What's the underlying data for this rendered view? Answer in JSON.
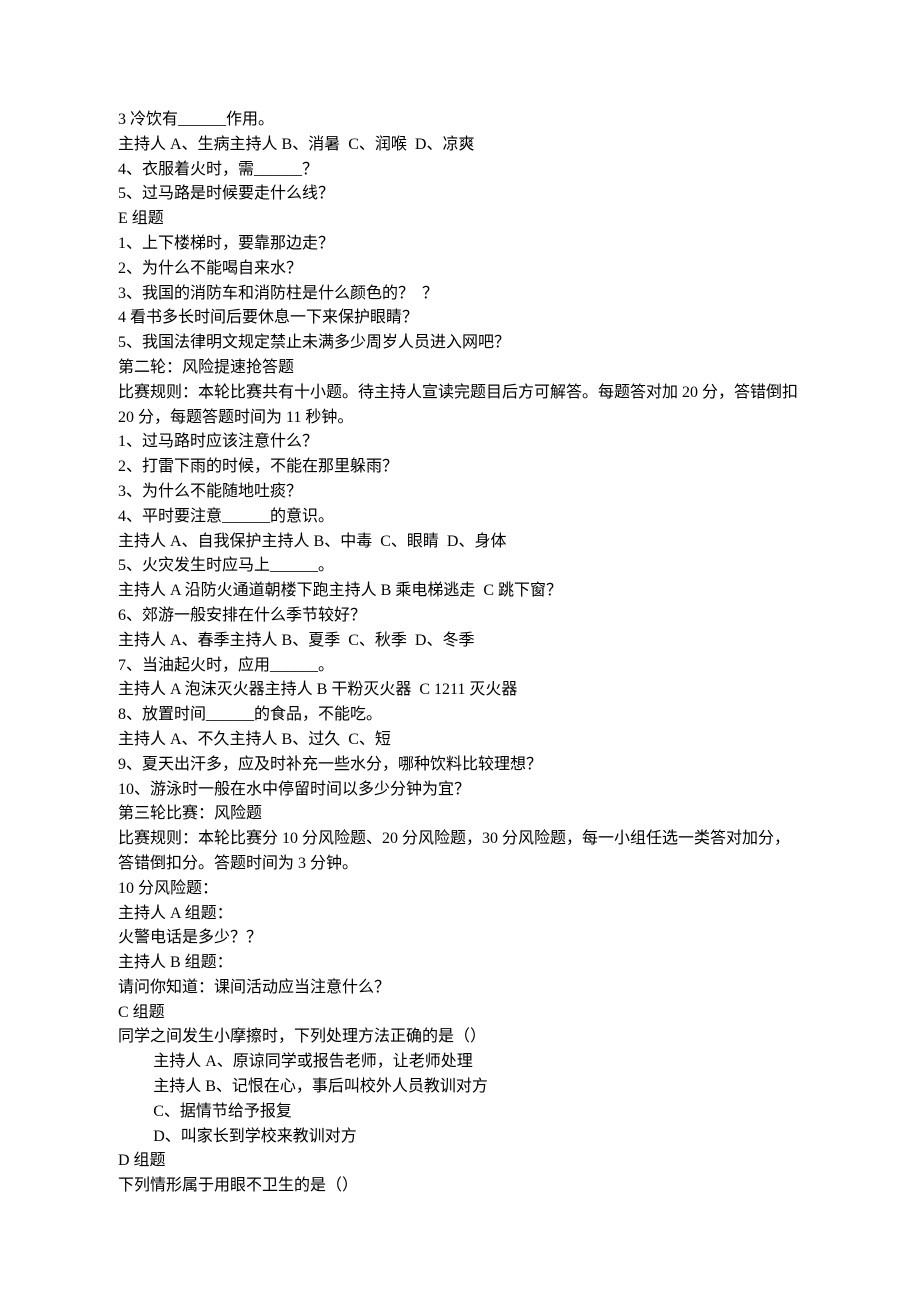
{
  "lines": [
    {
      "text": "3 冷饮有______作用。"
    },
    {
      "text": "主持人 A、生病主持人 B、消暑  C、润喉  D、凉爽"
    },
    {
      "text": "4、衣服着火时，需______？"
    },
    {
      "text": "5、过马路是时候要走什么线？"
    },
    {
      "text": "E 组题"
    },
    {
      "text": "1、上下楼梯时，要靠那边走？"
    },
    {
      "text": "2、为什么不能喝自来水？"
    },
    {
      "text": "3、我国的消防车和消防柱是什么颜色的？  ？"
    },
    {
      "text": "4 看书多长时间后要休息一下来保护眼睛？"
    },
    {
      "text": "5、我国法律明文规定禁止未满多少周岁人员进入网吧？"
    },
    {
      "text": "第二轮：风险提速抢答题"
    },
    {
      "text": "比赛规则：本轮比赛共有十小题。待主持人宣读完题目后方可解答。每题答对加 20 分，答错倒扣 20 分，每题答题时间为 11 秒钟。"
    },
    {
      "text": "1、过马路时应该注意什么？"
    },
    {
      "text": "2、打雷下雨的时候，不能在那里躲雨？"
    },
    {
      "text": "3、为什么不能随地吐痰？"
    },
    {
      "text": "4、平时要注意______的意识。"
    },
    {
      "text": "主持人 A、自我保护主持人 B、中毒  C、眼睛  D、身体"
    },
    {
      "text": "5、火灾发生时应马上______。"
    },
    {
      "text": "主持人 A 沿防火通道朝楼下跑主持人 B 乘电梯逃走  C 跳下窗？"
    },
    {
      "text": "6、郊游一般安排在什么季节较好？"
    },
    {
      "text": "主持人 A、春季主持人 B、夏季  C、秋季  D、冬季"
    },
    {
      "text": "7、当油起火时，应用______。"
    },
    {
      "text": "主持人 A 泡沫灭火器主持人 B 干粉灭火器  C 1211 灭火器"
    },
    {
      "text": "8、放置时间______的食品，不能吃。"
    },
    {
      "text": "主持人 A、不久主持人 B、过久  C、短"
    },
    {
      "text": "9、夏天出汗多，应及时补充一些水分，哪种饮料比较理想？"
    },
    {
      "text": "10、游泳时一般在水中停留时间以多少分钟为宜？"
    },
    {
      "text": "第三轮比赛：风险题"
    },
    {
      "text": "比赛规则：本轮比赛分 10 分风险题、20 分风险题，30 分风险题，每一小组任选一类答对加分，答错倒扣分。答题时间为 3 分钟。"
    },
    {
      "text": "10 分风险题："
    },
    {
      "text": "主持人 A 组题："
    },
    {
      "text": "火警电话是多少？？"
    },
    {
      "text": "主持人 B 组题："
    },
    {
      "text": "请问你知道：课间活动应当注意什么？"
    },
    {
      "text": "C 组题"
    },
    {
      "text": "同学之间发生小摩擦时，下列处理方法正确的是（）"
    },
    {
      "text": "主持人 A、原谅同学或报告老师，让老师处理",
      "indent": true
    },
    {
      "text": "主持人 B、记恨在心，事后叫校外人员教训对方",
      "indent": true
    },
    {
      "text": "C、据情节给予报复",
      "indent": true
    },
    {
      "text": "D、叫家长到学校来教训对方",
      "indent": true
    },
    {
      "text": "D 组题"
    },
    {
      "text": "下列情形属于用眼不卫生的是（）"
    }
  ]
}
